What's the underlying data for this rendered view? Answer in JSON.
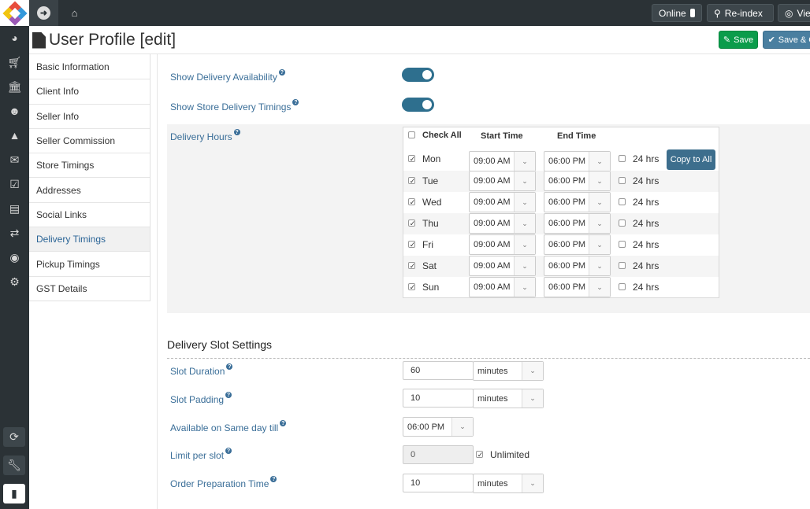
{
  "topbar": {
    "online_label": "Online",
    "reindex_label": "Re-index",
    "view_label": "View"
  },
  "header": {
    "title": "User Profile [edit]",
    "save_label": "Save",
    "save_close_label": "Save & Close"
  },
  "colors": {
    "topbar": "#2b3236",
    "save": "#0b9c4b",
    "save_close": "#4a7fa0",
    "toggle_on": "#2e6f8e",
    "link": "#3a6e98"
  },
  "tabs": [
    {
      "label": "Basic Information"
    },
    {
      "label": "Client Info"
    },
    {
      "label": "Seller Info"
    },
    {
      "label": "Seller Commission"
    },
    {
      "label": "Store Timings"
    },
    {
      "label": "Addresses"
    },
    {
      "label": "Social Links"
    },
    {
      "label": "Delivery Timings",
      "active": true
    },
    {
      "label": "Pickup Timings"
    },
    {
      "label": "GST Details"
    }
  ],
  "form": {
    "show_delivery_availability": {
      "label": "Show Delivery Availability",
      "on": true
    },
    "show_store_delivery_timings": {
      "label": "Show Store Delivery Timings",
      "on": true
    },
    "delivery_hours_label": "Delivery Hours"
  },
  "hours": {
    "check_all": "Check All",
    "start_time": "Start Time",
    "end_time": "End Time",
    "copy_to_all": "Copy to All",
    "h24": "24 hrs",
    "days": [
      {
        "day": "Mon",
        "checked": true,
        "start": "09:00 AM",
        "end": "06:00 PM",
        "all_day": false
      },
      {
        "day": "Tue",
        "checked": true,
        "start": "09:00 AM",
        "end": "06:00 PM",
        "all_day": false
      },
      {
        "day": "Wed",
        "checked": true,
        "start": "09:00 AM",
        "end": "06:00 PM",
        "all_day": false
      },
      {
        "day": "Thu",
        "checked": true,
        "start": "09:00 AM",
        "end": "06:00 PM",
        "all_day": false
      },
      {
        "day": "Fri",
        "checked": true,
        "start": "09:00 AM",
        "end": "06:00 PM",
        "all_day": false
      },
      {
        "day": "Sat",
        "checked": true,
        "start": "09:00 AM",
        "end": "06:00 PM",
        "all_day": false
      },
      {
        "day": "Sun",
        "checked": true,
        "start": "09:00 AM",
        "end": "06:00 PM",
        "all_day": false
      }
    ]
  },
  "slot": {
    "section_title": "Delivery Slot Settings",
    "slot_duration": {
      "label": "Slot Duration",
      "value": "60",
      "unit": "minutes"
    },
    "slot_padding": {
      "label": "Slot Padding",
      "value": "10",
      "unit": "minutes"
    },
    "same_day_till": {
      "label": "Available on Same day till",
      "value": "06:00 PM"
    },
    "limit_per_slot": {
      "label": "Limit per slot",
      "value": "0",
      "unlimited_label": "Unlimited",
      "unlimited": true
    },
    "prep_time": {
      "label": "Order Preparation Time",
      "value": "10",
      "unit": "minutes"
    }
  }
}
